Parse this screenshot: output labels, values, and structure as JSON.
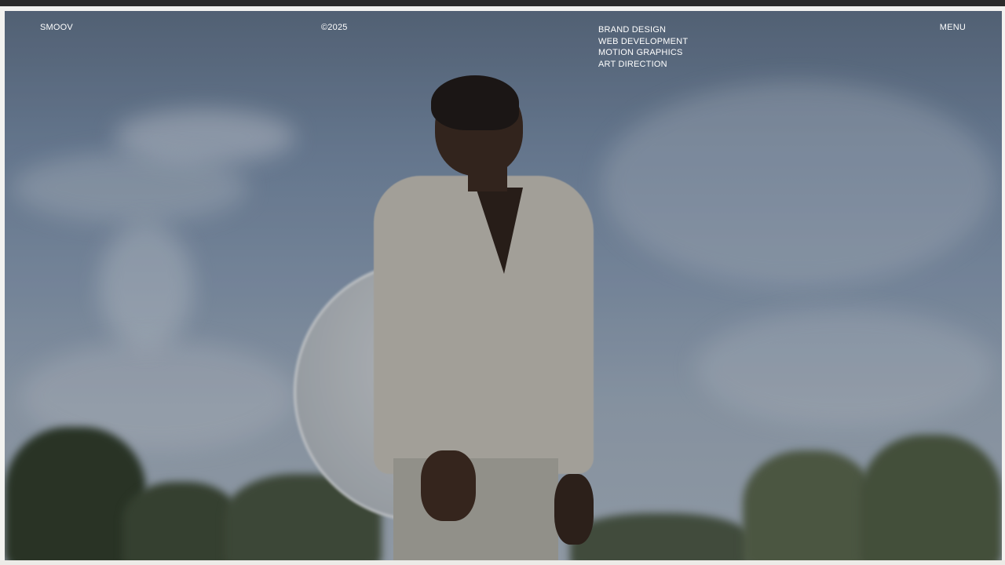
{
  "header": {
    "logo": "SMOOV",
    "year": "©2025",
    "services": [
      "BRAND DESIGN",
      "WEB DEVELOPMENT",
      "MOTION GRAPHICS",
      "ART DIRECTION"
    ],
    "menu_label": "MENU"
  },
  "hero": {
    "image": "hero-photo",
    "accent_color": "#ffffff"
  }
}
